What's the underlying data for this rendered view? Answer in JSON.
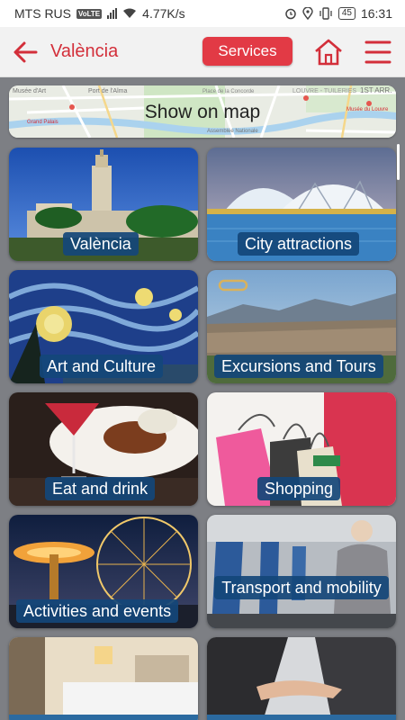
{
  "status_bar": {
    "carrier": "MTS RUS",
    "volte": "VoLTE",
    "speed": "4.77K/s",
    "battery": "45",
    "time": "16:31"
  },
  "app_bar": {
    "title": "València",
    "services_label": "Services"
  },
  "map": {
    "label": "Show on map",
    "street_labels": [
      "Musée d'Art",
      "Port de l'Alma",
      "Place de la Concorde",
      "LOUVRE - TUILERIES",
      "1ST ARR.",
      "Assemblée Nationale",
      "Musée du Louvre",
      "Grand Palais"
    ]
  },
  "tiles": [
    {
      "label": "València"
    },
    {
      "label": "City attractions"
    },
    {
      "label": "Art and Culture"
    },
    {
      "label": "Excursions and Tours"
    },
    {
      "label": "Eat and drink"
    },
    {
      "label": "Shopping"
    },
    {
      "label": "Activities and events"
    },
    {
      "label": "Transport and mobility"
    },
    {
      "label": ""
    },
    {
      "label": ""
    }
  ],
  "colors": {
    "accent": "#e23a45",
    "title_red": "#d32f3a",
    "label_bg": "#13467a",
    "page_bg": "#7d7f84"
  }
}
